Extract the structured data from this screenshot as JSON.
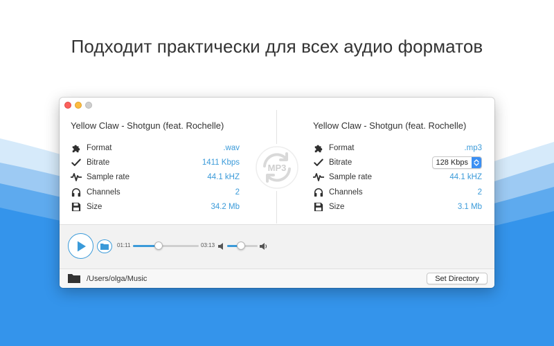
{
  "headline": "Подходит практически для всех аудио форматов",
  "colors": {
    "accent": "#3a9ad9",
    "wave_light": "#cfe6f8",
    "wave_mid": "#6fb3ee",
    "wave_dark": "#2f8fe8"
  },
  "source": {
    "title": "Yellow Claw - Shotgun (feat. Rochelle)",
    "rows": [
      {
        "icon": "puzzle-icon",
        "label": "Format",
        "value": ".wav"
      },
      {
        "icon": "checkmark-icon",
        "label": "Bitrate",
        "value": "1411 Kbps"
      },
      {
        "icon": "waveform-icon",
        "label": "Sample rate",
        "value": "44.1 kHZ"
      },
      {
        "icon": "headphones-icon",
        "label": "Channels",
        "value": "2"
      },
      {
        "icon": "floppy-disk-icon",
        "label": "Size",
        "value": "34.2 Mb"
      }
    ]
  },
  "convert_button": {
    "label": "MP3"
  },
  "target": {
    "title": "Yellow Claw - Shotgun (feat. Rochelle)",
    "rows": [
      {
        "icon": "puzzle-icon",
        "label": "Format",
        "value": ".mp3"
      },
      {
        "icon": "checkmark-icon",
        "label": "Bitrate",
        "value": "128 Kbps"
      },
      {
        "icon": "waveform-icon",
        "label": "Sample rate",
        "value": "44.1 kHZ"
      },
      {
        "icon": "headphones-icon",
        "label": "Channels",
        "value": "2"
      },
      {
        "icon": "floppy-disk-icon",
        "label": "Size",
        "value": "3.1 Mb"
      }
    ]
  },
  "player": {
    "current_time": "01:11",
    "total_time": "03:13",
    "progress_fraction": 0.39,
    "volume_fraction": 0.45
  },
  "footer": {
    "path": "/Users/olga/Music",
    "set_directory_label": "Set Directory"
  }
}
